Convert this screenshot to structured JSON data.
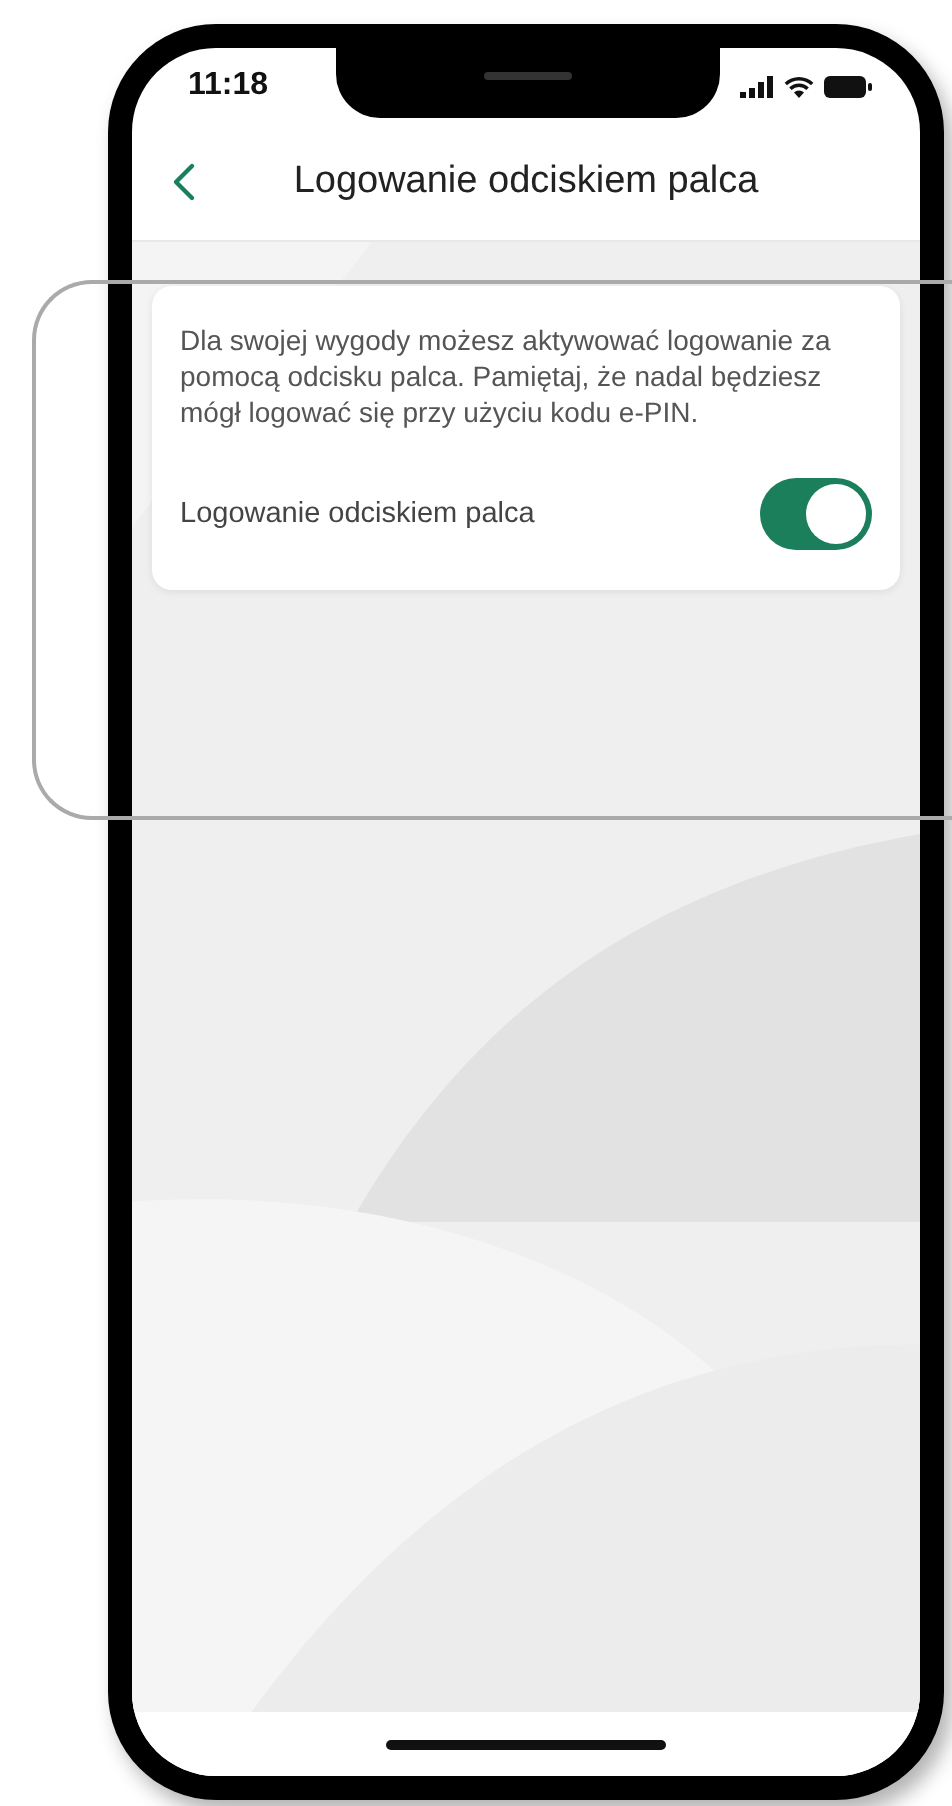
{
  "status_bar": {
    "time": "11:18"
  },
  "header": {
    "title": "Logowanie odciskiem palca"
  },
  "card": {
    "description": "Dla swojej wygody możesz aktywować logowanie za pomocą odcisku palca. Pamiętaj, że nadal będziesz mógł logować się przy użyciu kodu e-PIN.",
    "setting": {
      "label": "Logowanie odciskiem palca",
      "on": true
    }
  }
}
